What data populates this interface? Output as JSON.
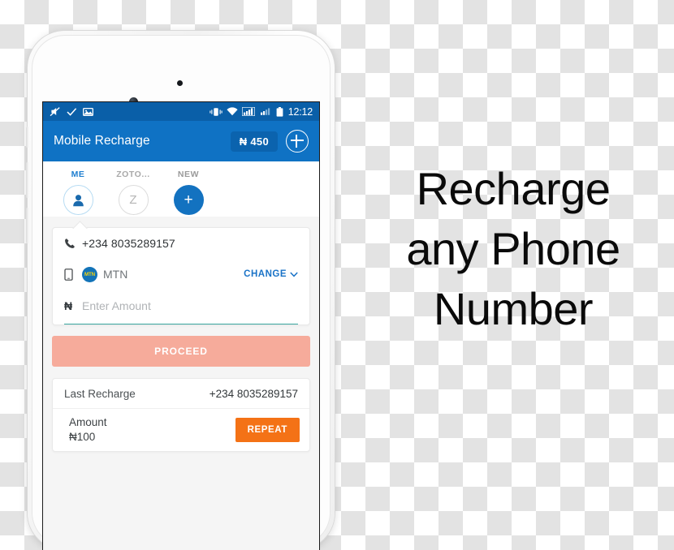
{
  "headline": {
    "line1": "Recharge",
    "line2": "any Phone",
    "line3": "Number"
  },
  "statusbar": {
    "icons_left": [
      "mute-icon",
      "check-icon",
      "screenshot-icon"
    ],
    "icons_right": [
      "vibrate-icon",
      "wifi-icon",
      "signal-sim1-icon",
      "signal-sim2-icon",
      "battery-icon"
    ],
    "time": "12:12"
  },
  "appbar": {
    "title": "Mobile Recharge",
    "balance": "₦ 450",
    "add_icon": "plus-circle-icon"
  },
  "tabs": [
    {
      "label": "ME",
      "avatar": "person-icon",
      "selected": true
    },
    {
      "label": "ZOTO...",
      "avatar": "Z",
      "selected": false
    },
    {
      "label": "NEW",
      "avatar": "+",
      "selected": false
    }
  ],
  "form": {
    "phone_icon": "phone-handset-icon",
    "phone_number": "+234 8035289157",
    "device_icon": "mobile-device-icon",
    "carrier_badge": "MTN",
    "carrier": "MTN",
    "change_label": "CHANGE",
    "change_icon": "chevron-down-icon",
    "currency_symbol": "₦",
    "amount_placeholder": "Enter Amount",
    "amount_value": ""
  },
  "proceed": {
    "label": "PROCEED"
  },
  "last_recharge": {
    "title": "Last Recharge",
    "number": "+234 8035289157",
    "amount_label": "Amount",
    "amount_value": "₦100",
    "repeat_label": "REPEAT"
  },
  "colors": {
    "statusbar": "#0a5fa8",
    "appbar": "#0f72c4",
    "accent_blue": "#1372c0",
    "proceed": "#f6ab9b",
    "repeat": "#f47216",
    "underline_teal": "#3aa6a0"
  }
}
